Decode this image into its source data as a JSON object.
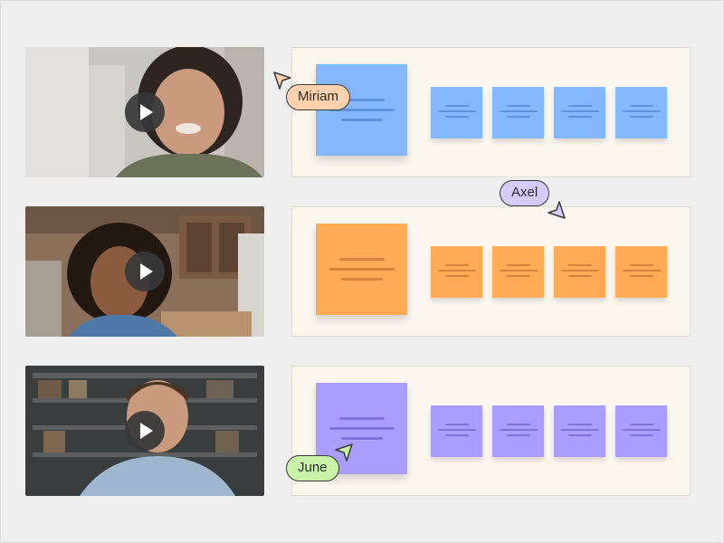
{
  "colors": {
    "blue_note": "#84b7ff",
    "blue_line": "#5f93df",
    "orange_note": "#ffab55",
    "orange_line": "#d9823e",
    "purple_note": "#a99dff",
    "purple_line": "#7f72dc",
    "miriam": "#ffd2ad",
    "axel": "#d5cbff",
    "june": "#c8f5a8"
  },
  "rows": [
    {
      "participant": "participant-1",
      "note_color": "blue"
    },
    {
      "participant": "participant-2",
      "note_color": "orange"
    },
    {
      "participant": "participant-3",
      "note_color": "purple"
    }
  ],
  "cursors": {
    "miriam": "Miriam",
    "axel": "Axel",
    "june": "June"
  }
}
